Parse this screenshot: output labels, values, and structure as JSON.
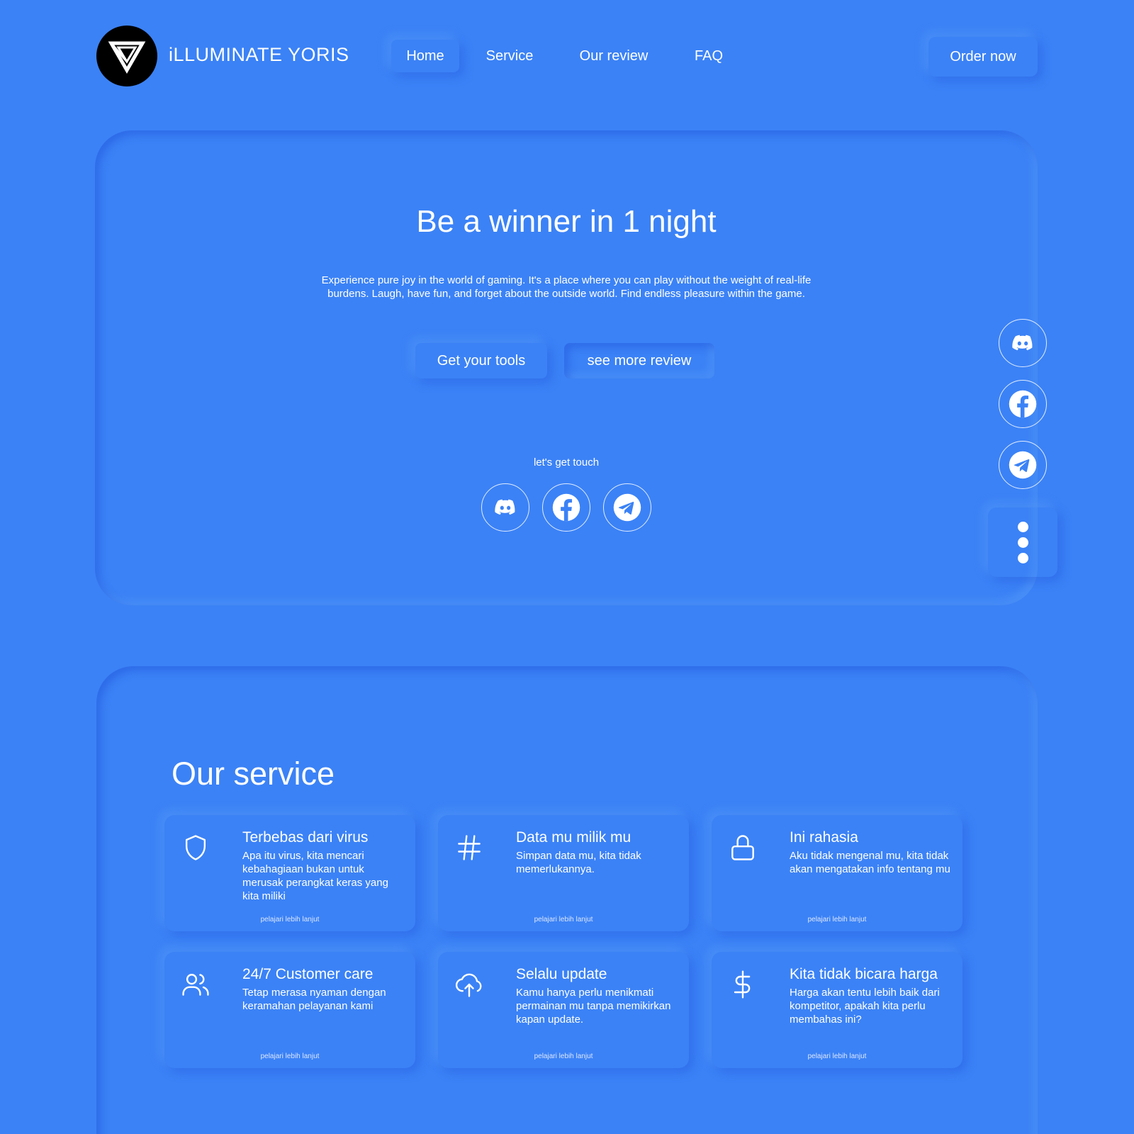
{
  "header": {
    "brand": "iLLUMINATE YORIS",
    "nav": [
      "Home",
      "Service",
      "Our review",
      "FAQ"
    ],
    "order_label": "Order now"
  },
  "hero": {
    "title": "Be a winner in 1 night",
    "text": "Experience pure joy in the world of gaming. It's a place where you can play without the weight of real-life burdens. Laugh, have fun, and forget about the outside world. Find endless pleasure within the game.",
    "primary_button": "Get your tools",
    "secondary_button": "see more review",
    "touch_label": "let's get touch"
  },
  "social_icons": [
    "discord-icon",
    "facebook-icon",
    "telegram-icon"
  ],
  "services": {
    "title": "Our service",
    "cards": [
      {
        "icon": "shield-icon",
        "title": "Terbebas dari virus",
        "desc": "Apa itu virus, kita mencari kebahagiaan bukan untuk merusak perangkat keras yang kita miliki",
        "link": "pelajari lebih lanjut"
      },
      {
        "icon": "hash-icon",
        "title": "Data mu milik mu",
        "desc": "Simpan data mu, kita tidak memerlukannya.",
        "link": "pelajari lebih lanjut"
      },
      {
        "icon": "lock-icon",
        "title": "Ini rahasia",
        "desc": "Aku tidak mengenal mu, kita tidak akan mengatakan info tentang mu",
        "link": "pelajari lebih lanjut"
      },
      {
        "icon": "users-icon",
        "title": "24/7 Customer care",
        "desc": "Tetap merasa nyaman dengan keramahan pelayanan kami",
        "link": "pelajari lebih lanjut"
      },
      {
        "icon": "upload-cloud-icon",
        "title": "Selalu update",
        "desc": "Kamu hanya perlu menikmati permainan mu tanpa memikirkan kapan update.",
        "link": "pelajari lebih lanjut"
      },
      {
        "icon": "dollar-icon",
        "title": "Kita tidak bicara harga",
        "desc": "Harga akan tentu lebih baik dari kompetitor, apakah kita perlu membahas ini?",
        "link": "pelajari lebih lanjut"
      }
    ]
  },
  "colors": {
    "background": "#3b82f6",
    "text": "#ffffff",
    "logo_bg": "#000000"
  }
}
